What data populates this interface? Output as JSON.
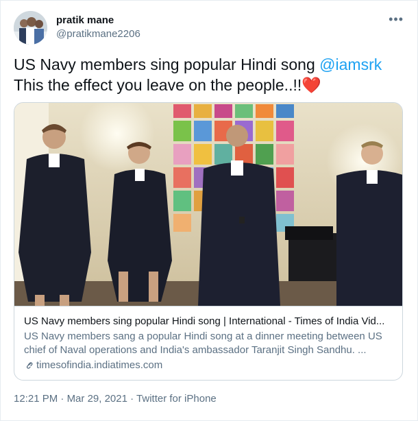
{
  "author": {
    "display_name": "pratik mane",
    "handle": "@pratikmane2206",
    "avatar_icon": "user-avatar"
  },
  "more_icon": "more-horizontal-icon",
  "tweet": {
    "text_part1": "US Navy members sing popular Hindi song ",
    "mention": "@iamsrk",
    "text_part2": "This the effect you leave on the people..!!",
    "emoji": "❤️"
  },
  "card": {
    "title": "US Navy members sing popular Hindi song | International - Times of India Vid...",
    "description": "US Navy members sang a popular Hindi song at a dinner meeting between US chief of Naval operations and India's ambassador Taranjit Singh Sandhu. ...",
    "domain": "timesofindia.indiatimes.com",
    "link_icon": "link-icon"
  },
  "meta": {
    "time": "12:21 PM",
    "separator": "·",
    "date": "Mar 29, 2021",
    "source": "Twitter for iPhone"
  },
  "colors": {
    "accent": "#1da1f2",
    "secondary_text": "#5b7083",
    "heart": "#e0245e"
  }
}
